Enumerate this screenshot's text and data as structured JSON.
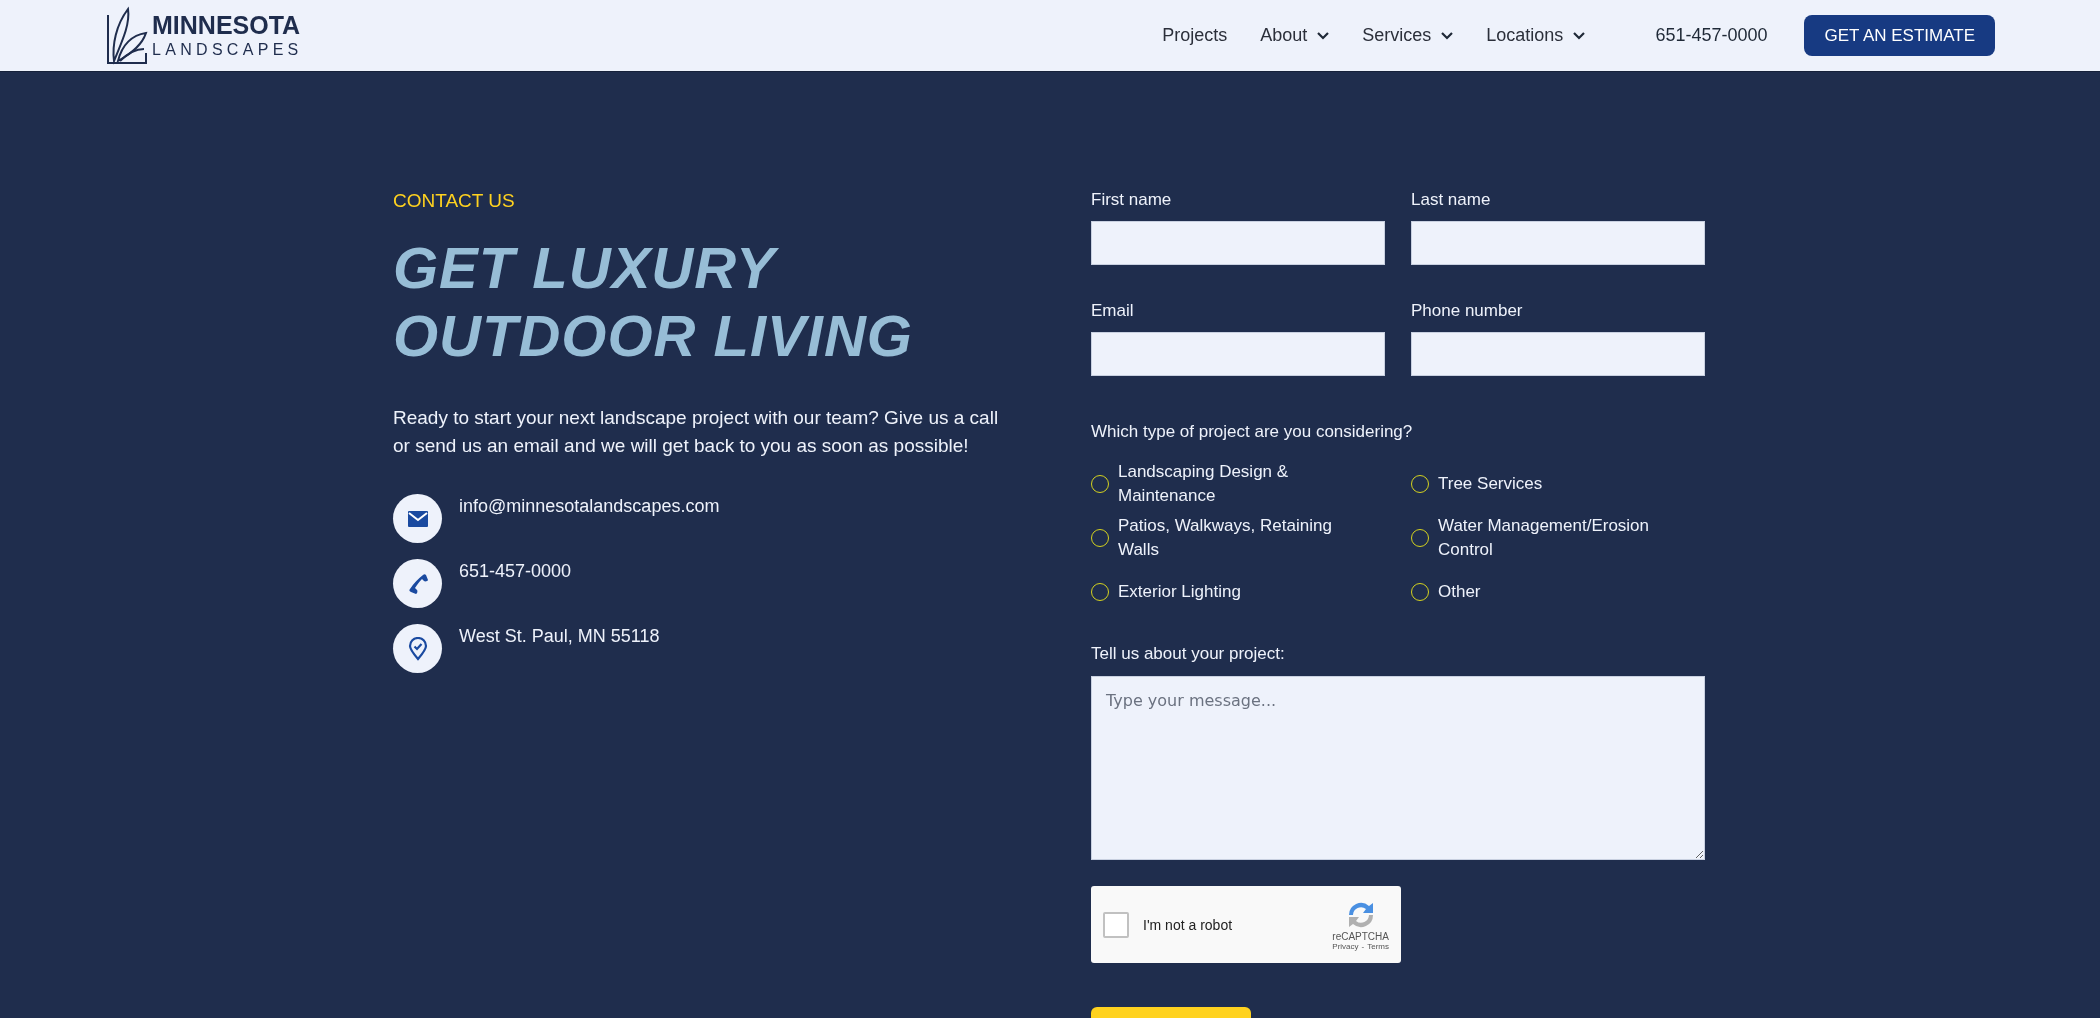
{
  "header": {
    "logo": {
      "name": "MINNESOTA",
      "tagline": "LANDSCAPES"
    },
    "nav": [
      {
        "label": "Projects",
        "dropdown": false
      },
      {
        "label": "About",
        "dropdown": true
      },
      {
        "label": "Services",
        "dropdown": true
      },
      {
        "label": "Locations",
        "dropdown": true
      }
    ],
    "phone": "651-457-0000",
    "cta": "GET AN ESTIMATE"
  },
  "contact": {
    "eyebrow": "CONTACT US",
    "heading": "GET LUXURY OUTDOOR LIVING",
    "intro": "Ready to start your next landscape project with our team? Give us a call or send us an email and we will get back to you as soon as possible!",
    "items": [
      {
        "kind": "email",
        "text": "info@minnesotalandscapes.com"
      },
      {
        "kind": "phone",
        "text": "651-457-0000"
      },
      {
        "kind": "location",
        "text": "West St. Paul, MN 55118"
      }
    ]
  },
  "form": {
    "fields": [
      {
        "label": "First name"
      },
      {
        "label": "Last name"
      },
      {
        "label": "Email"
      },
      {
        "label": "Phone number"
      }
    ],
    "question": "Which type of project are you considering?",
    "options": [
      {
        "label": "Landscaping Design & Maintenance",
        "selected": false
      },
      {
        "label": "Tree Services",
        "selected": false
      },
      {
        "label": "Patios, Walkways, Retaining Walls",
        "selected": false
      },
      {
        "label": "Water Management/Erosion Control",
        "selected": false
      },
      {
        "label": "Exterior Lighting",
        "selected": false
      },
      {
        "label": "Other",
        "selected": false
      }
    ],
    "message": {
      "label": "Tell us about your project:",
      "placeholder": "Type your message..."
    },
    "captcha": {
      "label": "I'm not a robot",
      "checked": false,
      "brand": "reCAPTCHA",
      "privacy": "Privacy",
      "separator": "-",
      "terms": "Terms"
    }
  }
}
